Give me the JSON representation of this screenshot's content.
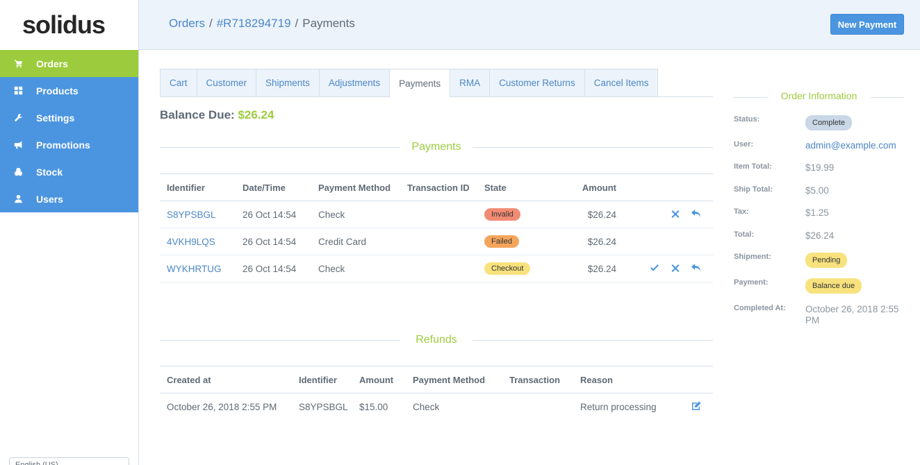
{
  "brand": {
    "logo": "solidus"
  },
  "sidebar": {
    "items": [
      {
        "label": "Orders",
        "icon": "cart-icon"
      },
      {
        "label": "Products",
        "icon": "grid-icon"
      },
      {
        "label": "Settings",
        "icon": "wrench-icon"
      },
      {
        "label": "Promotions",
        "icon": "megaphone-icon"
      },
      {
        "label": "Stock",
        "icon": "cubes-icon"
      },
      {
        "label": "Users",
        "icon": "user-icon"
      }
    ],
    "locale": "English (US)"
  },
  "header": {
    "breadcrumb": [
      "Orders",
      "#R718294719",
      "Payments"
    ],
    "new_payment_label": "New Payment"
  },
  "tabs": [
    "Cart",
    "Customer",
    "Shipments",
    "Adjustments",
    "Payments",
    "RMA",
    "Customer Returns",
    "Cancel Items"
  ],
  "balance": {
    "label": "Balance Due:",
    "value": "$26.24"
  },
  "payments": {
    "title": "Payments",
    "columns": [
      "Identifier",
      "Date/Time",
      "Payment Method",
      "Transaction ID",
      "State",
      "Amount"
    ],
    "rows": [
      {
        "identifier": "S8YPSBGL",
        "datetime": "26 Oct 14:54",
        "method": "Check",
        "transaction": "",
        "state": "Invalid",
        "amount": "$26.24"
      },
      {
        "identifier": "4VKH9LQS",
        "datetime": "26 Oct 14:54",
        "method": "Credit Card",
        "transaction": "",
        "state": "Failed",
        "amount": "$26.24"
      },
      {
        "identifier": "WYKHRTUG",
        "datetime": "26 Oct 14:54",
        "method": "Check",
        "transaction": "",
        "state": "Checkout",
        "amount": "$26.24"
      }
    ]
  },
  "refunds": {
    "title": "Refunds",
    "columns": [
      "Created at",
      "Identifier",
      "Amount",
      "Payment Method",
      "Transaction",
      "Reason"
    ],
    "rows": [
      {
        "created": "October 26, 2018 2:55 PM",
        "identifier": "S8YPSBGL",
        "amount": "$15.00",
        "method": "Check",
        "transaction": "",
        "reason": "Return processing"
      }
    ]
  },
  "order_info": {
    "title": "Order Information",
    "status_label": "Status:",
    "status": "Complete",
    "user_label": "User:",
    "user": "admin@example.com",
    "item_total_label": "Item Total:",
    "item_total": "$19.99",
    "ship_total_label": "Ship Total:",
    "ship_total": "$5.00",
    "tax_label": "Tax:",
    "tax": "$1.25",
    "total_label": "Total:",
    "total": "$26.24",
    "shipment_label": "Shipment:",
    "shipment": "Pending",
    "payment_label": "Payment:",
    "payment": "Balance due",
    "completed_label": "Completed At:",
    "completed": "October 26, 2018 2:55 PM"
  },
  "colors": {
    "accent_green": "#9ccc3d",
    "nav_blue": "#4b95e0",
    "invalid": "#f28b74",
    "failed": "#f5a55b",
    "checkout": "#f8e27d",
    "complete": "#c9d7e6",
    "pending": "#f8e27d"
  }
}
